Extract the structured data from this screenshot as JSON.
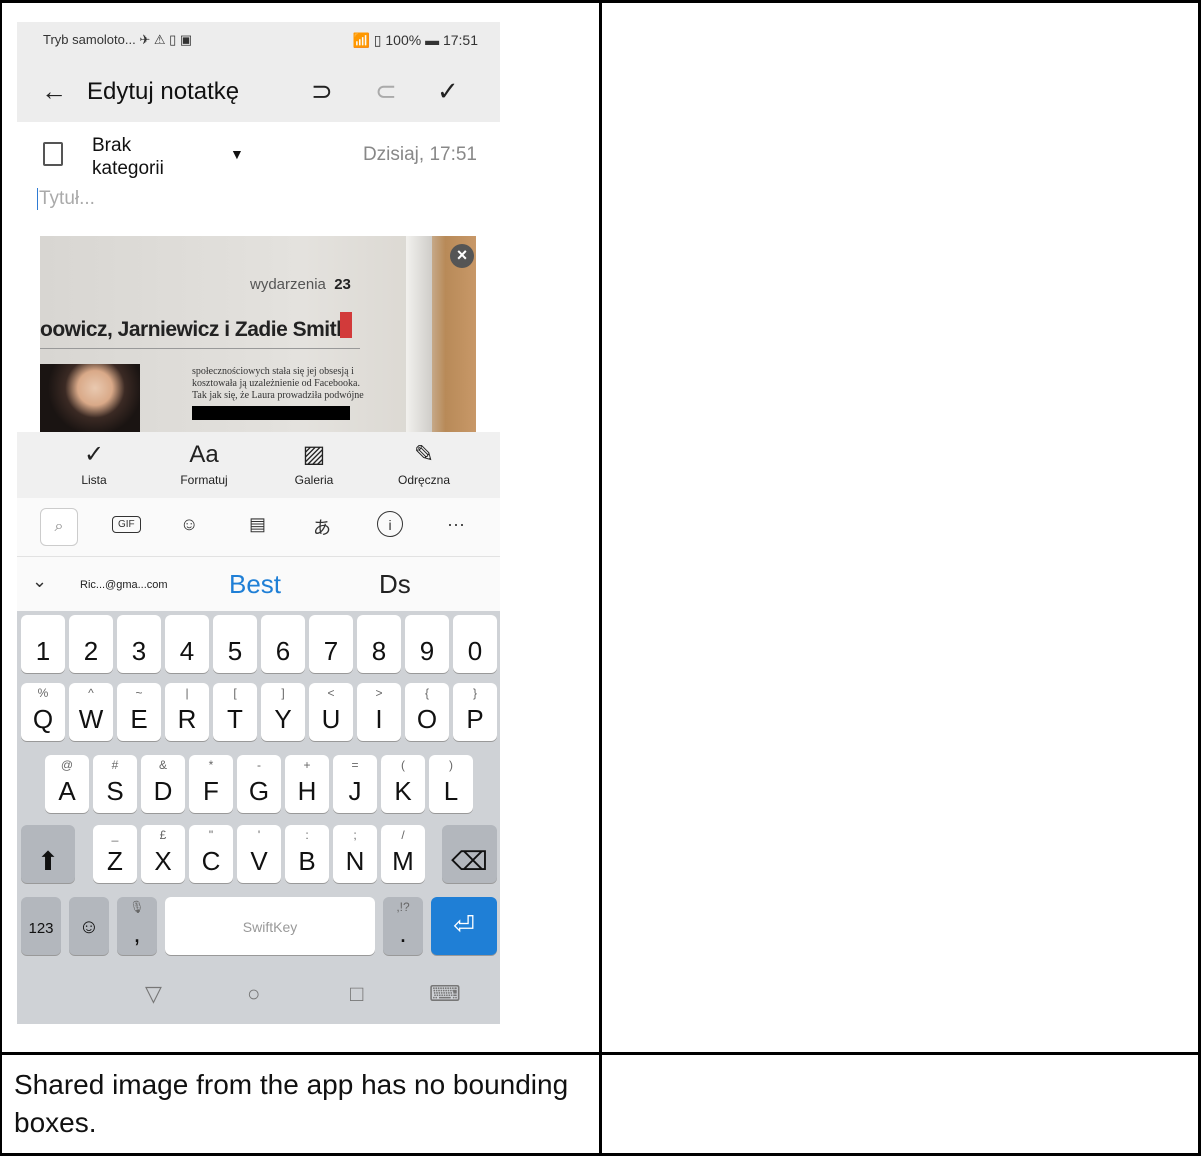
{
  "status_bar": {
    "left": "Tryb samoloto... ✈ ⚠ ▯ ▣",
    "right": "📶 ▯ 100% ▬ 17:51"
  },
  "app_bar": {
    "title": "Edytuj notatkę",
    "back_icon": "←",
    "undo_icon": "⊃",
    "redo_icon": "⊂",
    "check_icon": "✓"
  },
  "note": {
    "category": "Brak kategorii",
    "category_arrow": "▼",
    "date": "Dzisiaj, 17:51",
    "title_placeholder": "Tytuł..."
  },
  "photo": {
    "section": "wydarzenia",
    "page": "23",
    "headline": "oowicz, Jarniewicz i Zadie Smith",
    "body_text": "społecznościowych stała się jej obsesją i kosztowała ją uzależnienie od Facebooka. Tak jak się, że Laura prowadziła podwójne",
    "close_icon": "×"
  },
  "toolbar": [
    {
      "label": "Lista",
      "icon": "✓"
    },
    {
      "label": "Formatuj",
      "icon": "Aa"
    },
    {
      "label": "Galeria",
      "icon": "▨"
    },
    {
      "label": "Odręczna",
      "icon": "✎"
    }
  ],
  "kb_strip": {
    "gif": "GIF",
    "sticker": "☺",
    "clipboard": "▤",
    "translate": "あ",
    "info": "i",
    "more": "···",
    "search": "⌕"
  },
  "suggestions": {
    "collapse": "⌄",
    "email": "Ric...@gma...com",
    "best": "Best",
    "ds": "Ds"
  },
  "keyboard": {
    "row1": [
      "1",
      "2",
      "3",
      "4",
      "5",
      "6",
      "7",
      "8",
      "9",
      "0"
    ],
    "row2": [
      [
        "Q",
        "%"
      ],
      [
        "W",
        "^"
      ],
      [
        "E",
        "~"
      ],
      [
        "R",
        "|"
      ],
      [
        "T",
        "["
      ],
      [
        "Y",
        "]"
      ],
      [
        "U",
        "<"
      ],
      [
        "I",
        ">"
      ],
      [
        "O",
        "{"
      ],
      [
        "P",
        "}"
      ]
    ],
    "row3": [
      [
        "A",
        "@"
      ],
      [
        "S",
        "#"
      ],
      [
        "D",
        "&"
      ],
      [
        "F",
        "*"
      ],
      [
        "G",
        "-"
      ],
      [
        "H",
        "+"
      ],
      [
        "J",
        "="
      ],
      [
        "K",
        "("
      ],
      [
        "L",
        ")"
      ]
    ],
    "row4": [
      [
        "Z",
        "_"
      ],
      [
        "X",
        "£"
      ],
      [
        "C",
        "\""
      ],
      [
        "V",
        "'"
      ],
      [
        "B",
        ":"
      ],
      [
        "N",
        ";"
      ],
      [
        "M",
        "/"
      ]
    ],
    "shift": "⬆",
    "backspace": "⌫",
    "num": "123",
    "emoji": "☺",
    "comma": ",",
    "mic": "🎙",
    "space_label": "SwiftKey",
    "period": ".",
    "period_alt": ",!?",
    "enter": "⏎"
  },
  "nav": {
    "back": "▽",
    "home": "○",
    "recent": "□",
    "keyboard": "⌨"
  },
  "caption": "Shared image from the app has no bounding boxes."
}
